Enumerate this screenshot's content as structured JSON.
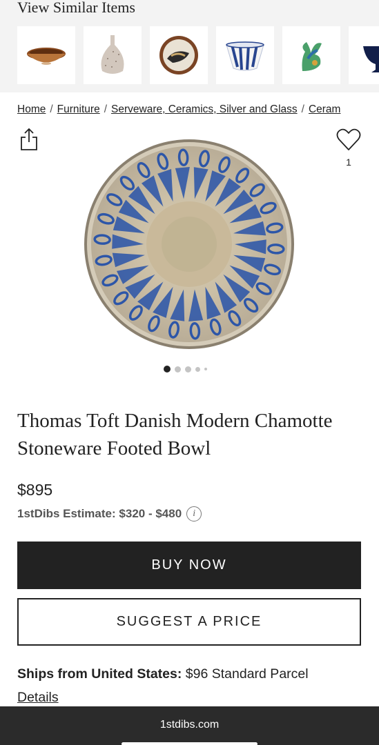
{
  "similar": {
    "title": "View Similar Items",
    "items": [
      {
        "icon": "brown-bowl-thumbnail"
      },
      {
        "icon": "speckled-vase-thumbnail"
      },
      {
        "icon": "decorative-plate-thumbnail"
      },
      {
        "icon": "blue-white-bowl-thumbnail"
      },
      {
        "icon": "green-sculpture-thumbnail"
      },
      {
        "icon": "navy-footed-bowl-thumbnail"
      }
    ]
  },
  "breadcrumb": {
    "items": [
      "Home",
      "Furniture",
      "Serveware, Ceramics, Silver and Glass",
      "Ceram"
    ],
    "separator": "/"
  },
  "actions": {
    "share_icon": "share-icon",
    "favorite_icon": "heart-icon",
    "favorite_count": "1"
  },
  "carousel": {
    "count": 5,
    "active_index": 0
  },
  "product": {
    "title": "Thomas Toft Danish Modern Chamotte Stoneware Footed Bowl",
    "price": "$895",
    "estimate_label": "1stDibs Estimate:",
    "estimate_value": "$320 - $480",
    "info_icon": "i"
  },
  "buttons": {
    "buy_now": "BUY NOW",
    "suggest_price": "SUGGEST A PRICE"
  },
  "shipping": {
    "label": "Ships from United States:",
    "value": "$96 Standard Parcel",
    "details_link": "Details"
  },
  "browser": {
    "url": "1stdibs.com"
  },
  "colors": {
    "primary": "#222222",
    "strip_background": "#f3f3f3",
    "bowl_blue": "#2d56a8",
    "bowl_clay": "#cfc3ab"
  }
}
